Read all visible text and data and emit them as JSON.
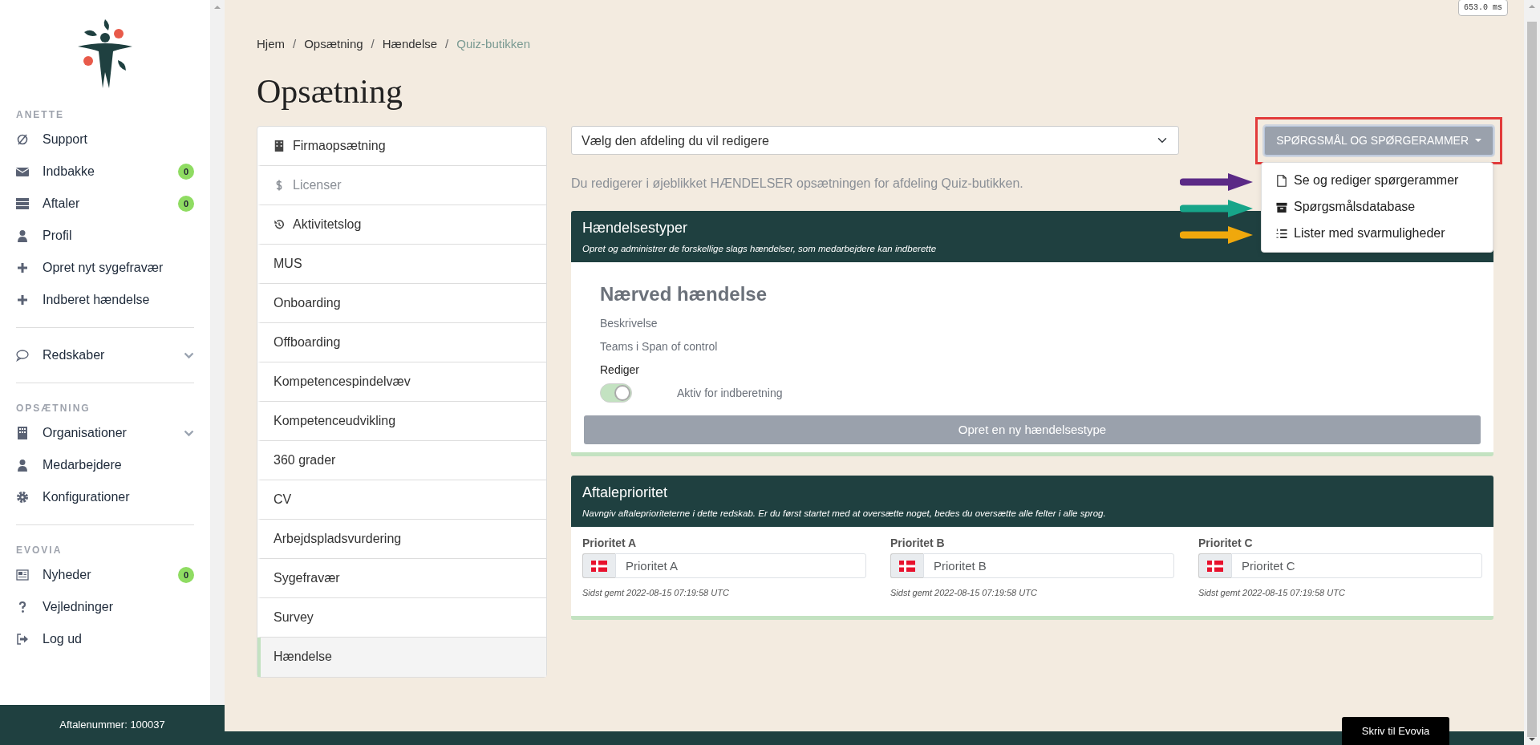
{
  "perf_badge": "653.0 ms",
  "sidebar": {
    "sections": [
      {
        "heading": "ANETTE",
        "items": [
          {
            "label": "Support",
            "has_submenu": false
          },
          {
            "label": "Indbakke",
            "badge": "0",
            "has_submenu": false
          },
          {
            "label": "Aftaler",
            "badge": "0",
            "has_submenu": false
          },
          {
            "label": "Profil",
            "has_submenu": false
          },
          {
            "label": "Opret nyt sygefravær",
            "has_submenu": false
          },
          {
            "label": "Indberet hændelse",
            "has_submenu": false
          }
        ]
      },
      {
        "items": [
          {
            "label": "Redskaber",
            "has_submenu": true
          }
        ]
      },
      {
        "heading": "OPSÆTNING",
        "items": [
          {
            "label": "Organisationer",
            "has_submenu": true
          },
          {
            "label": "Medarbejdere",
            "has_submenu": false
          },
          {
            "label": "Konfigurationer",
            "has_submenu": false
          }
        ]
      },
      {
        "heading": "EVOVIA",
        "items": [
          {
            "label": "Nyheder",
            "badge": "0",
            "has_submenu": false
          },
          {
            "label": "Vejledninger",
            "has_submenu": false
          },
          {
            "label": "Log ud",
            "has_submenu": false
          }
        ]
      }
    ],
    "footer": "Aftalenummer: 100037"
  },
  "breadcrumb": [
    {
      "label": "Hjem",
      "active": false
    },
    {
      "separator": "/",
      "label": "Opsætning",
      "active": false
    },
    {
      "separator": "/",
      "label": "Hændelse",
      "active": false
    },
    {
      "separator": "/",
      "label": "Quiz-butikken",
      "active": true
    }
  ],
  "page_title": "Opsætning",
  "settings_menu": [
    {
      "label": "Firmaopsætning",
      "disabled": false,
      "selected": false
    },
    {
      "label": "Licenser",
      "disabled": true,
      "selected": false
    },
    {
      "label": "Aktivitetslog",
      "disabled": false,
      "selected": false
    },
    {
      "label": "MUS",
      "disabled": false,
      "selected": false
    },
    {
      "label": "Onboarding",
      "disabled": false,
      "selected": false
    },
    {
      "label": "Offboarding",
      "disabled": false,
      "selected": false
    },
    {
      "label": "Kompetencespindelvæv",
      "disabled": false,
      "selected": false
    },
    {
      "label": "Kompetenceudvikling",
      "disabled": false,
      "selected": false
    },
    {
      "label": "360 grader",
      "disabled": false,
      "selected": false
    },
    {
      "label": "CV",
      "disabled": false,
      "selected": false
    },
    {
      "label": "Arbejdspladsvurdering",
      "disabled": false,
      "selected": false
    },
    {
      "label": "Sygefravær",
      "disabled": false,
      "selected": false
    },
    {
      "label": "Survey",
      "disabled": false,
      "selected": false
    },
    {
      "label": "Hændelse",
      "disabled": false,
      "selected": true
    }
  ],
  "department_select": {
    "value": "Vælg den afdeling du vil redigere"
  },
  "help_text": "Du redigerer i øjeblikket HÆNDELSER opsætningen for afdeling Quiz-butikken.",
  "dropdown": {
    "label": "SPØRGSMÅL OG SPØRGERAMMER",
    "highlighted": true,
    "expanded": true,
    "items": [
      {
        "label": "Se og rediger spørgerammer",
        "color": "#5b2a86"
      },
      {
        "label": "Spørgsmålsdatabase",
        "color": "#17a589"
      },
      {
        "label": "Lister med svarmuligheder",
        "color": "#f0a80c"
      }
    ]
  },
  "event_types_card": {
    "title": "Hændelsestyper",
    "subtitle": "Opret og administrer de forskellige slags hændelser, som medarbejdere kan indberette",
    "event": {
      "name": "Nærved hændelse",
      "description_label": "Beskrivelse",
      "teams": "Teams i Span of control",
      "edit_link": "Rediger",
      "toggle": {
        "label": "Aktiv for indberetning",
        "on": true
      }
    },
    "create_button": "Opret en ny hændelsestype"
  },
  "priority_card": {
    "title": "Aftaleprioritet",
    "subtitle": "Navngiv aftaleprioriteterne i dette redskab. Er du først startet med at oversætte noget, bedes du oversætte alle felter i alle sprog.",
    "fields": [
      {
        "label": "Prioritet A",
        "placeholder": "Prioritet A",
        "saved": "Sidst gemt 2022-08-15 07:19:58 UTC"
      },
      {
        "label": "Prioritet B",
        "placeholder": "Prioritet B",
        "saved": "Sidst gemt 2022-08-15 07:19:58 UTC"
      },
      {
        "label": "Prioritet C",
        "placeholder": "Prioritet C",
        "saved": "Sidst gemt 2022-08-15 07:19:58 UTC"
      }
    ]
  },
  "chat_button": "Skriv til Evovia"
}
